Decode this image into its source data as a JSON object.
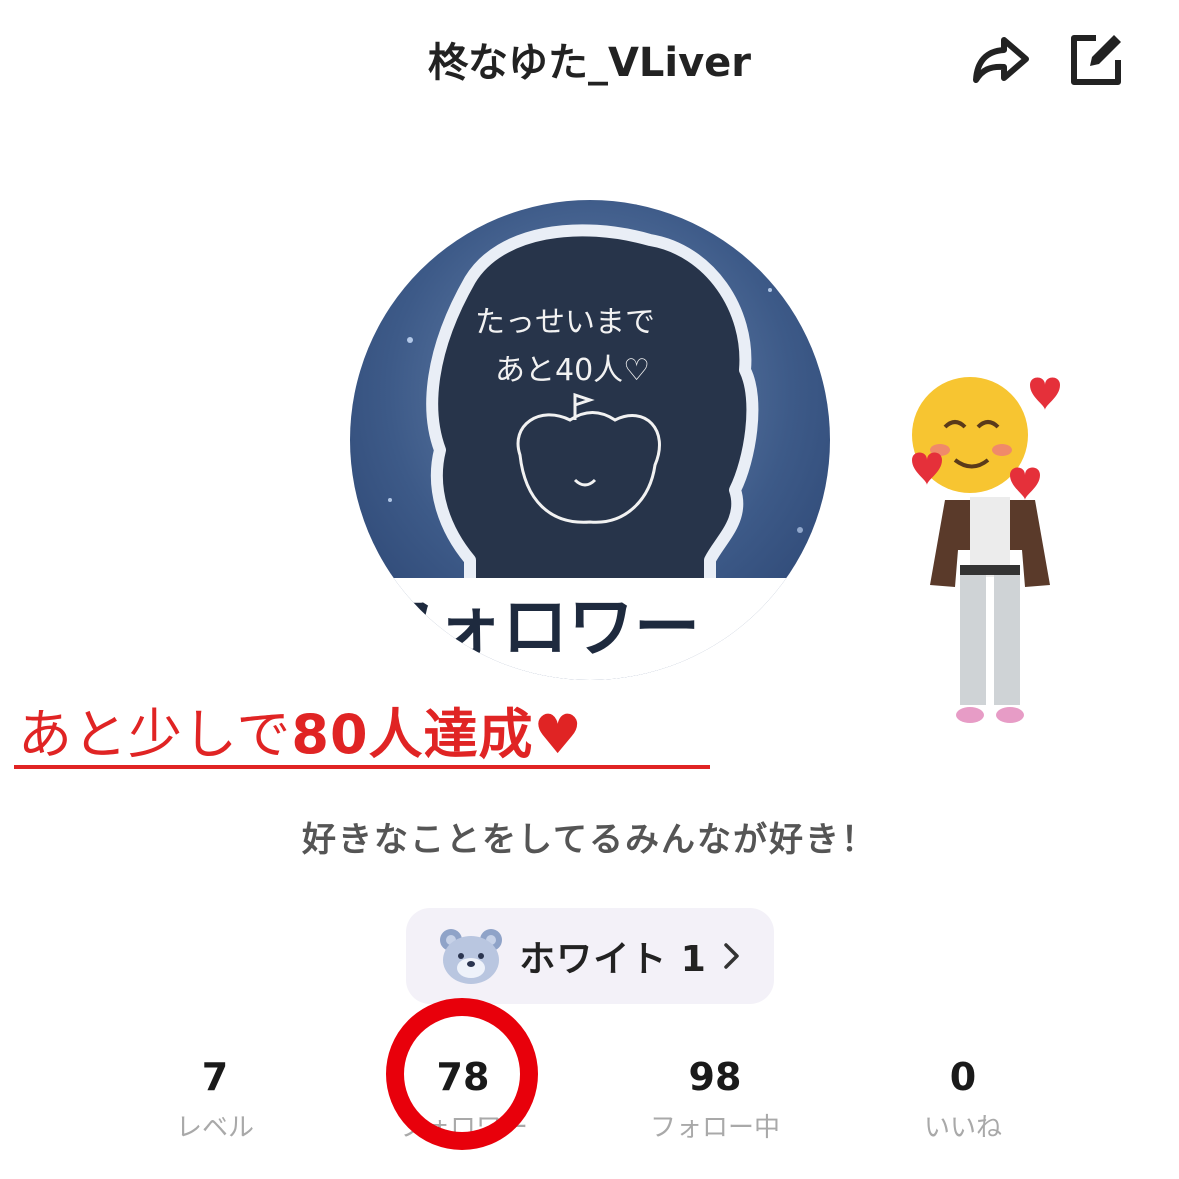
{
  "header": {
    "title": "柊なゆた_VLiver",
    "share_icon": "share-arrow-icon",
    "edit_icon": "edit-icon"
  },
  "avatar": {
    "handwriting_line1": "たっせいまで",
    "handwriting_line2": "あと40人♡",
    "banner_text": "フォロワー"
  },
  "overlay": {
    "text_serif": "あと少しで",
    "text_bold": "80人達成",
    "heart": "♥",
    "color": "#e02424"
  },
  "bio": "好きなことをしてるみんなが好き！",
  "rank": {
    "label": "ホワイト 1",
    "icon": "bear-icon",
    "chevron": "›"
  },
  "stats": [
    {
      "value": "7",
      "label": "レベル"
    },
    {
      "value": "78",
      "label": "フォロワー"
    },
    {
      "value": "98",
      "label": "フォロー中"
    },
    {
      "value": "0",
      "label": "いいね"
    }
  ],
  "highlight_color": "#e8000b"
}
